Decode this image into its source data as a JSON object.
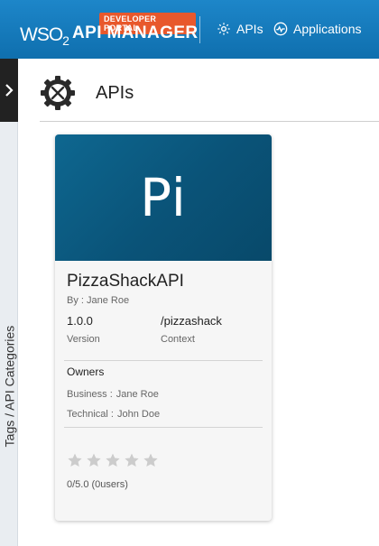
{
  "header": {
    "brand": "WSO",
    "brand_sub": "2",
    "portal_badge": "DEVELOPER PORTAL",
    "product": "API MANAGER",
    "nav": [
      {
        "label": "APIs",
        "icon": "gear-icon"
      },
      {
        "label": "Applications",
        "icon": "pulse-icon"
      }
    ]
  },
  "sidebar": {
    "toggle_icon": "chevron-right-icon",
    "label": "Tags / API Categories"
  },
  "page": {
    "title": "APIs",
    "title_icon": "gear-tools-icon"
  },
  "api_card": {
    "thumbnail_text": "Pi",
    "name": "PizzaShackAPI",
    "by": "By : Jane Roe",
    "version_value": "1.0.0",
    "version_label": "Version",
    "context_value": "/pizzashack",
    "context_label": "Context",
    "owners_title": "Owners",
    "business_label": "Business :",
    "business_value": "Jane Roe",
    "technical_label": "Technical :",
    "technical_value": "John Doe",
    "rating": {
      "value": 0,
      "max": 5
    },
    "rating_text": "0/5.0 (0users)"
  },
  "colors": {
    "header": "#1479bd",
    "badge": "#e8582c",
    "thumbnail": "#0a5378",
    "star_empty": "#cccccc"
  }
}
